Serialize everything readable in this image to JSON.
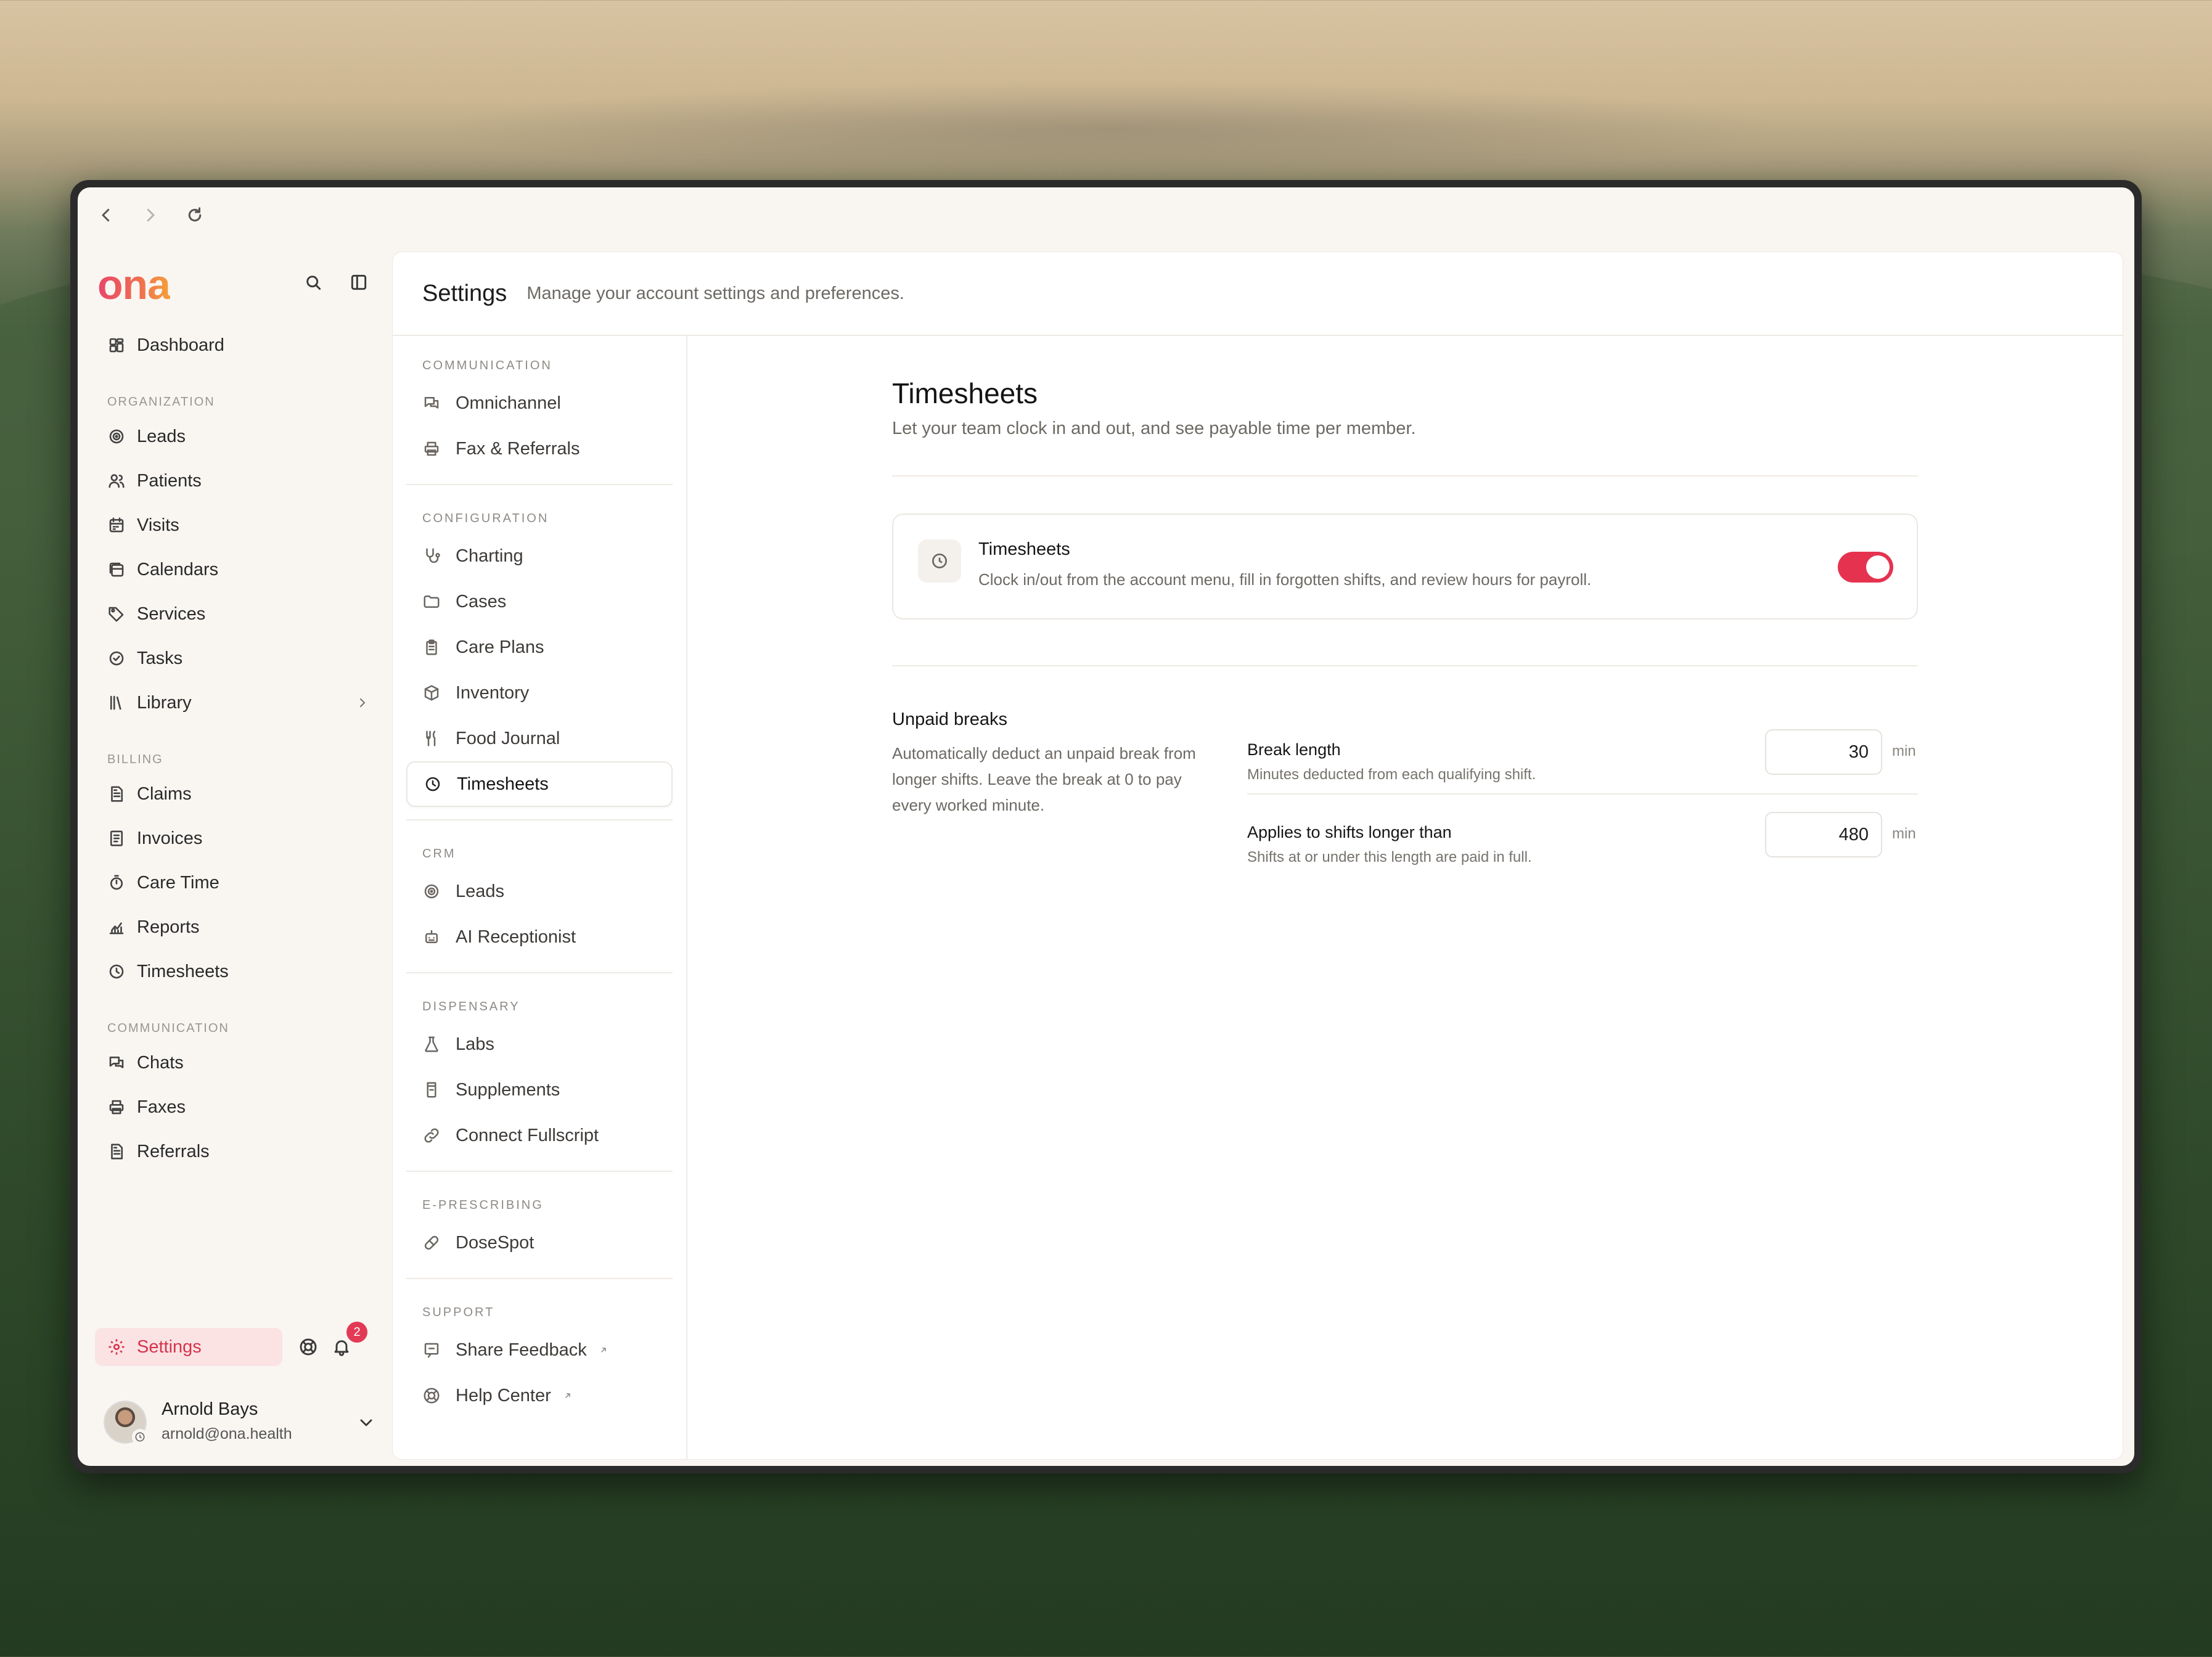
{
  "browser": {
    "back_icon": "chevron-left-icon",
    "forward_icon": "chevron-right-icon",
    "reload_icon": "reload-icon"
  },
  "sidebar": {
    "logo": "ona",
    "nav": [
      {
        "type": "item",
        "label": "Dashboard",
        "icon": "dashboard-icon"
      },
      {
        "type": "section",
        "label": "ORGANIZATION"
      },
      {
        "type": "item",
        "label": "Leads",
        "icon": "target-icon"
      },
      {
        "type": "item",
        "label": "Patients",
        "icon": "users-icon"
      },
      {
        "type": "item",
        "label": "Visits",
        "icon": "calendar-grid-icon"
      },
      {
        "type": "item",
        "label": "Calendars",
        "icon": "calendars-icon"
      },
      {
        "type": "item",
        "label": "Services",
        "icon": "tag-icon"
      },
      {
        "type": "item",
        "label": "Tasks",
        "icon": "check-circle-icon"
      },
      {
        "type": "item",
        "label": "Library",
        "icon": "library-icon",
        "chevron": true
      },
      {
        "type": "section",
        "label": "BILLING"
      },
      {
        "type": "item",
        "label": "Claims",
        "icon": "document-icon"
      },
      {
        "type": "item",
        "label": "Invoices",
        "icon": "invoice-icon"
      },
      {
        "type": "item",
        "label": "Care Time",
        "icon": "stopwatch-icon"
      },
      {
        "type": "item",
        "label": "Reports",
        "icon": "chart-icon"
      },
      {
        "type": "item",
        "label": "Timesheets",
        "icon": "clock-icon"
      },
      {
        "type": "section",
        "label": "COMMUNICATION"
      },
      {
        "type": "item",
        "label": "Chats",
        "icon": "chat-icon"
      },
      {
        "type": "item",
        "label": "Faxes",
        "icon": "printer-icon"
      },
      {
        "type": "item",
        "label": "Referrals",
        "icon": "document-icon"
      }
    ],
    "settings_label": "Settings",
    "notifications_count": "2",
    "user": {
      "name": "Arnold Bays",
      "email": "arnold@ona.health"
    }
  },
  "main": {
    "title": "Settings",
    "subtitle": "Manage your account settings and preferences.",
    "subnav": [
      {
        "section": "COMMUNICATION",
        "items": [
          {
            "label": "Omnichannel",
            "icon": "chat-icon"
          },
          {
            "label": "Fax & Referrals",
            "icon": "printer-icon"
          }
        ]
      },
      {
        "section": "CONFIGURATION",
        "items": [
          {
            "label": "Charting",
            "icon": "stethoscope-icon"
          },
          {
            "label": "Cases",
            "icon": "folder-icon"
          },
          {
            "label": "Care Plans",
            "icon": "clipboard-icon"
          },
          {
            "label": "Inventory",
            "icon": "box-icon"
          },
          {
            "label": "Food Journal",
            "icon": "utensils-icon"
          },
          {
            "label": "Timesheets",
            "icon": "clock-icon",
            "active": true
          }
        ]
      },
      {
        "section": "CRM",
        "items": [
          {
            "label": "Leads",
            "icon": "target-icon"
          },
          {
            "label": "AI Receptionist",
            "icon": "robot-icon"
          }
        ]
      },
      {
        "section": "DISPENSARY",
        "items": [
          {
            "label": "Labs",
            "icon": "flask-icon"
          },
          {
            "label": "Supplements",
            "icon": "bottle-icon"
          },
          {
            "label": "Connect Fullscript",
            "icon": "link-icon"
          }
        ]
      },
      {
        "section": "E-PRESCRIBING",
        "items": [
          {
            "label": "DoseSpot",
            "icon": "pill-icon"
          }
        ]
      },
      {
        "section": "SUPPORT",
        "items": [
          {
            "label": "Share Feedback",
            "icon": "feedback-icon",
            "external": true
          },
          {
            "label": "Help Center",
            "icon": "lifebuoy-icon",
            "external": true
          }
        ]
      }
    ],
    "content": {
      "title": "Timesheets",
      "description": "Let your team clock in and out, and see payable time per member.",
      "toggle_card": {
        "title": "Timesheets",
        "description": "Clock in/out from the account menu, fill in forgotten shifts, and review hours for payroll.",
        "enabled": true,
        "accent": "#e5334f"
      },
      "unpaid_breaks": {
        "title": "Unpaid breaks",
        "description": "Automatically deduct an unpaid break from longer shifts. Leave the break at 0 to pay every worked minute."
      },
      "fields": [
        {
          "label": "Break length",
          "help": "Minutes deducted from each qualifying shift.",
          "value": "30",
          "unit": "min"
        },
        {
          "label": "Applies to shifts longer than",
          "help": "Shifts at or under this length are paid in full.",
          "value": "480",
          "unit": "min"
        }
      ]
    }
  }
}
